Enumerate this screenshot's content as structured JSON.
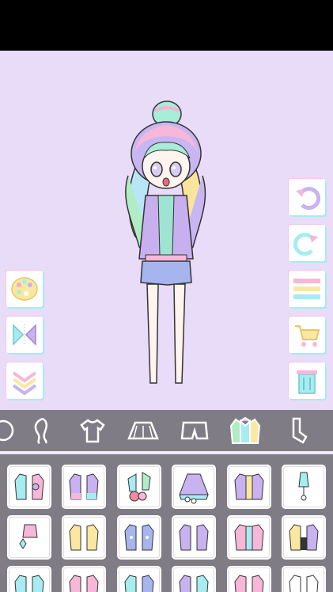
{
  "app": {
    "colors": {
      "stage_bg": "#e9dcf8",
      "bar_bg": "#807c86",
      "accent_pink": "#f7c6e6",
      "accent_cyan": "#a6ecf1",
      "accent_yellow": "#fbe8a0",
      "accent_purple": "#c8b2f0"
    }
  },
  "side_left": {
    "buttons": [
      {
        "id": "palette",
        "icon": "palette-icon"
      },
      {
        "id": "flip",
        "icon": "flip-icon"
      },
      {
        "id": "layer-down",
        "icon": "chevron-down-icon"
      }
    ]
  },
  "side_right": {
    "buttons": [
      {
        "id": "undo",
        "icon": "undo-icon"
      },
      {
        "id": "redo",
        "icon": "redo-icon"
      },
      {
        "id": "menu",
        "icon": "menu-icon"
      },
      {
        "id": "cart",
        "icon": "cart-icon"
      },
      {
        "id": "trash",
        "icon": "trash-icon"
      }
    ]
  },
  "categories": [
    {
      "id": "accessory",
      "icon": "accessory-icon",
      "selected": false
    },
    {
      "id": "hair",
      "icon": "hair-icon",
      "selected": false
    },
    {
      "id": "shirt",
      "icon": "shirt-icon",
      "selected": false
    },
    {
      "id": "skirt",
      "icon": "skirt-icon",
      "selected": false
    },
    {
      "id": "shorts",
      "icon": "shorts-icon",
      "selected": false
    },
    {
      "id": "jacket",
      "icon": "jacket-icon",
      "selected": true
    },
    {
      "id": "socks",
      "icon": "socks-icon",
      "selected": false
    }
  ],
  "items": [
    {
      "id": "jacket-1",
      "icon": "jacket-item-icon"
    },
    {
      "id": "jacket-2",
      "icon": "jacket-item-icon"
    },
    {
      "id": "jacket-3",
      "icon": "jacket-item-icon"
    },
    {
      "id": "jacket-4",
      "icon": "dress-item-icon"
    },
    {
      "id": "jacket-5",
      "icon": "jacket-item-icon"
    },
    {
      "id": "jacket-6",
      "icon": "jacket-item-icon"
    },
    {
      "id": "jacket-7",
      "icon": "jacket-item-icon"
    },
    {
      "id": "jacket-8",
      "icon": "jacket-item-icon"
    },
    {
      "id": "jacket-9",
      "icon": "jacket-item-icon"
    },
    {
      "id": "jacket-10",
      "icon": "jacket-item-icon"
    },
    {
      "id": "jacket-11",
      "icon": "jacket-item-icon"
    },
    {
      "id": "jacket-12",
      "icon": "hoodie-item-icon"
    },
    {
      "id": "jacket-13",
      "icon": "jacket-item-icon"
    },
    {
      "id": "jacket-14",
      "icon": "jacket-item-icon"
    },
    {
      "id": "jacket-15",
      "icon": "jacket-item-icon"
    },
    {
      "id": "jacket-16",
      "icon": "jacket-item-icon"
    },
    {
      "id": "jacket-17",
      "icon": "jacket-item-icon"
    },
    {
      "id": "jacket-18",
      "icon": "jacket-item-icon"
    }
  ]
}
